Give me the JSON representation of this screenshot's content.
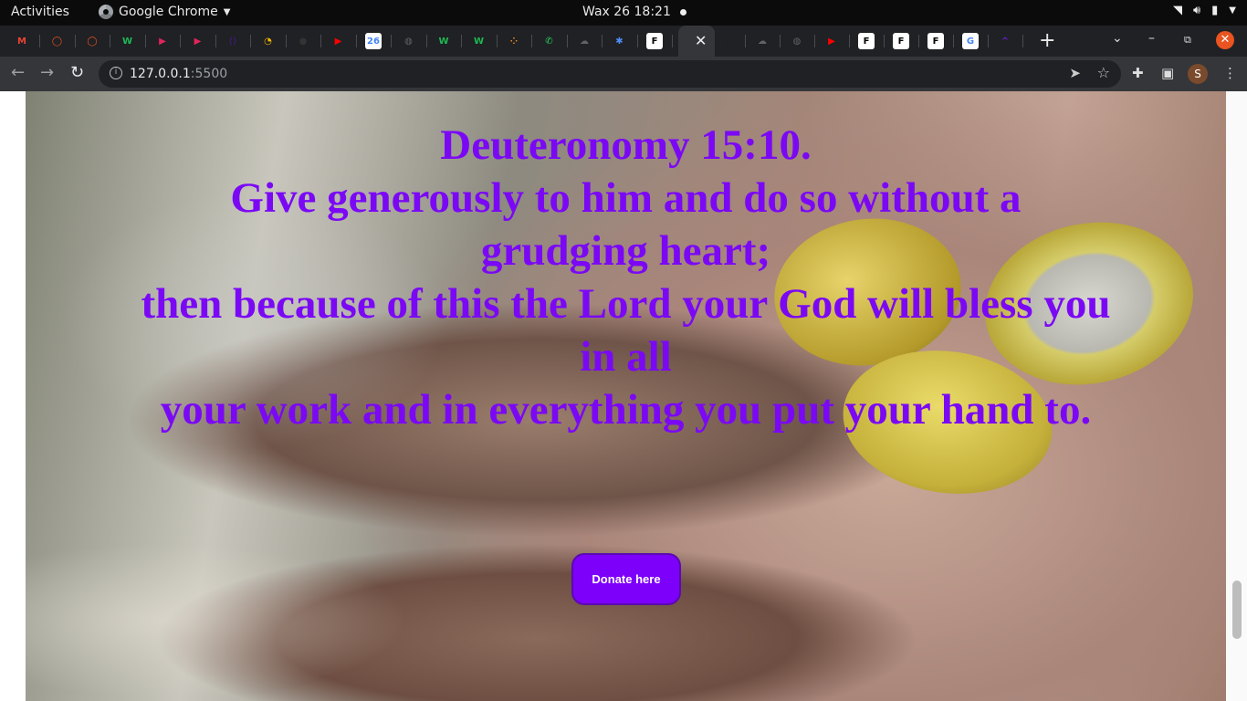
{
  "system_bar": {
    "activities": "Activities",
    "app_name": "Google Chrome",
    "clock": "Wax 26  18:21"
  },
  "tabs": {
    "favicons": [
      {
        "name": "gmail-icon",
        "glyph": "M",
        "color": "#ea4335"
      },
      {
        "name": "ubuntu-icon",
        "glyph": "◯",
        "color": "#e95420"
      },
      {
        "name": "ubuntu-icon",
        "glyph": "◯",
        "color": "#e95420"
      },
      {
        "name": "w-icon",
        "glyph": "W",
        "color": "#1db954"
      },
      {
        "name": "player-icon",
        "glyph": "▶",
        "color": "#e3245b"
      },
      {
        "name": "player-icon",
        "glyph": "▶",
        "color": "#e3245b"
      },
      {
        "name": "code-icon",
        "glyph": "⟨⟩",
        "color": "#3a1d73"
      },
      {
        "name": "drive-icon",
        "glyph": "◔",
        "color": "#fbbc04"
      },
      {
        "name": "github-icon",
        "glyph": "●",
        "color": "#333"
      },
      {
        "name": "youtube-icon",
        "glyph": "▶",
        "color": "#ff0000"
      },
      {
        "name": "calendar-icon",
        "glyph": "26",
        "color": "#4285f4"
      },
      {
        "name": "globe-icon",
        "glyph": "◍",
        "color": "#5f6368"
      },
      {
        "name": "w-icon",
        "glyph": "W",
        "color": "#1db954"
      },
      {
        "name": "w-icon",
        "glyph": "W",
        "color": "#1db954"
      },
      {
        "name": "dots-icon",
        "glyph": "⁘",
        "color": "#f28b1c"
      },
      {
        "name": "whatsapp-icon",
        "glyph": "✆",
        "color": "#25d366"
      },
      {
        "name": "cloud-icon",
        "glyph": "☁",
        "color": "#5f6368"
      },
      {
        "name": "puzzle-icon",
        "glyph": "✱",
        "color": "#4f8ef7"
      },
      {
        "name": "f-icon",
        "glyph": "F",
        "color": "#000"
      }
    ],
    "active_close": "✕",
    "favicons_after": [
      {
        "name": "terminal-icon",
        "glyph": "⌸",
        "color": "#202124"
      },
      {
        "name": "cloud-icon",
        "glyph": "☁",
        "color": "#5f6368"
      },
      {
        "name": "globe-icon",
        "glyph": "◍",
        "color": "#5f6368"
      },
      {
        "name": "youtube-icon",
        "glyph": "▶",
        "color": "#ff0000"
      },
      {
        "name": "f-icon",
        "glyph": "F",
        "color": "#000"
      },
      {
        "name": "f-icon",
        "glyph": "F",
        "color": "#000"
      },
      {
        "name": "f-icon",
        "glyph": "F",
        "color": "#000"
      },
      {
        "name": "google-icon",
        "glyph": "G",
        "color": "#4285f4"
      },
      {
        "name": "caret-icon",
        "glyph": "^",
        "color": "#6a1bd1"
      }
    ]
  },
  "toolbar": {
    "url_host": "127.0.0.1",
    "url_port": ":5500",
    "profile_initial": "S"
  },
  "page": {
    "verse_lines": [
      "Deuteronomy 15:10.",
      "Give generously to him and do so without a grudging heart;",
      "then because of this the Lord your God will bless you in all",
      "your work and in everything you put your hand to."
    ],
    "donate_label": "Donate here"
  },
  "colors": {
    "verse": "#7b08f5",
    "donate_bg": "#7d00fa"
  }
}
